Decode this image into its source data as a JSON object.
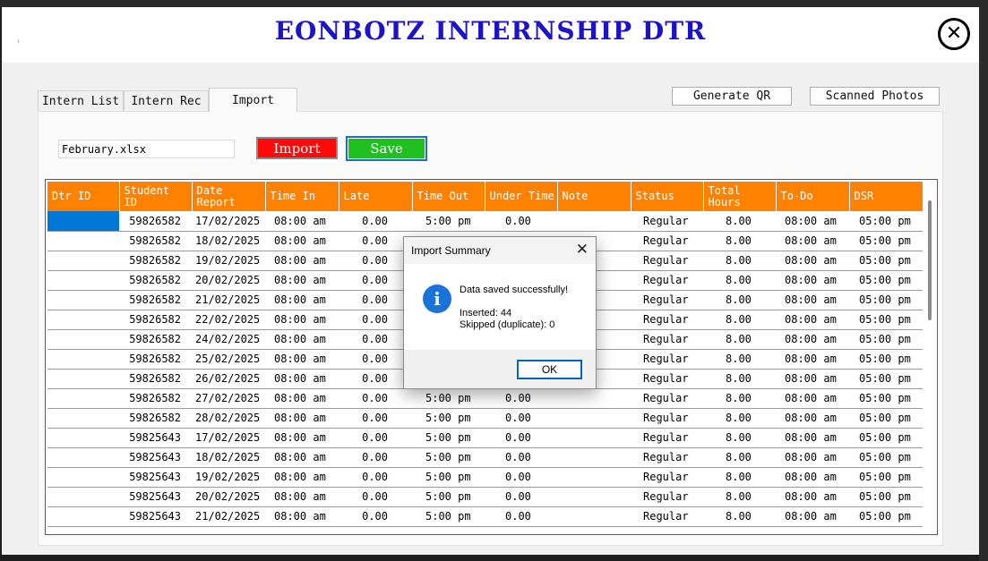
{
  "window": {
    "title": "EONBOTZ INTERNSHIP DTR",
    "close_symbol": "✕"
  },
  "tabs": [
    {
      "label": "Intern List"
    },
    {
      "label": "Intern Rec"
    },
    {
      "label": "Import",
      "active": true
    }
  ],
  "actions": {
    "generate_qr": "Generate QR",
    "scanned_photos": "Scanned Photos"
  },
  "import_panel": {
    "file_name": "February.xlsx",
    "import_label": "Import",
    "save_label": "Save",
    "colors": {
      "import": "#ff0a0a",
      "save": "#1fc01f",
      "header": "#ff8100",
      "title": "#1e12c9"
    }
  },
  "grid": {
    "columns": [
      "Dtr ID",
      "Student ID",
      "Date Report",
      "Time In",
      "Late",
      "Time Out",
      "Under Time",
      "Note",
      "Status",
      "Total Hours",
      "To-Do",
      "DSR"
    ],
    "rows": [
      [
        "",
        "59826582",
        "17/02/2025",
        "08:00 am",
        "0.00",
        "5:00 pm",
        "0.00",
        "",
        "Regular",
        "8.00",
        "08:00 am",
        "05:00 pm"
      ],
      [
        "",
        "59826582",
        "18/02/2025",
        "08:00 am",
        "0.00",
        "",
        "",
        "",
        "Regular",
        "8.00",
        "08:00 am",
        "05:00 pm"
      ],
      [
        "",
        "59826582",
        "19/02/2025",
        "08:00 am",
        "0.00",
        "",
        "",
        "",
        "Regular",
        "8.00",
        "08:00 am",
        "05:00 pm"
      ],
      [
        "",
        "59826582",
        "20/02/2025",
        "08:00 am",
        "0.00",
        "",
        "",
        "",
        "Regular",
        "8.00",
        "08:00 am",
        "05:00 pm"
      ],
      [
        "",
        "59826582",
        "21/02/2025",
        "08:00 am",
        "0.00",
        "",
        "",
        "",
        "Regular",
        "8.00",
        "08:00 am",
        "05:00 pm"
      ],
      [
        "",
        "59826582",
        "22/02/2025",
        "08:00 am",
        "0.00",
        "",
        "",
        "",
        "Regular",
        "8.00",
        "08:00 am",
        "05:00 pm"
      ],
      [
        "",
        "59826582",
        "24/02/2025",
        "08:00 am",
        "0.00",
        "",
        "",
        "",
        "Regular",
        "8.00",
        "08:00 am",
        "05:00 pm"
      ],
      [
        "",
        "59826582",
        "25/02/2025",
        "08:00 am",
        "0.00",
        "",
        "",
        "",
        "Regular",
        "8.00",
        "08:00 am",
        "05:00 pm"
      ],
      [
        "",
        "59826582",
        "26/02/2025",
        "08:00 am",
        "0.00",
        "",
        "",
        "",
        "Regular",
        "8.00",
        "08:00 am",
        "05:00 pm"
      ],
      [
        "",
        "59826582",
        "27/02/2025",
        "08:00 am",
        "0.00",
        "5:00 pm",
        "0.00",
        "",
        "Regular",
        "8.00",
        "08:00 am",
        "05:00 pm"
      ],
      [
        "",
        "59826582",
        "28/02/2025",
        "08:00 am",
        "0.00",
        "5:00 pm",
        "0.00",
        "",
        "Regular",
        "8.00",
        "08:00 am",
        "05:00 pm"
      ],
      [
        "",
        "59825643",
        "17/02/2025",
        "08:00 am",
        "0.00",
        "5:00 pm",
        "0.00",
        "",
        "Regular",
        "8.00",
        "08:00 am",
        "05:00 pm"
      ],
      [
        "",
        "59825643",
        "18/02/2025",
        "08:00 am",
        "0.00",
        "5:00 pm",
        "0.00",
        "",
        "Regular",
        "8.00",
        "08:00 am",
        "05:00 pm"
      ],
      [
        "",
        "59825643",
        "19/02/2025",
        "08:00 am",
        "0.00",
        "5:00 pm",
        "0.00",
        "",
        "Regular",
        "8.00",
        "08:00 am",
        "05:00 pm"
      ],
      [
        "",
        "59825643",
        "20/02/2025",
        "08:00 am",
        "0.00",
        "5:00 pm",
        "0.00",
        "",
        "Regular",
        "8.00",
        "08:00 am",
        "05:00 pm"
      ],
      [
        "",
        "59825643",
        "21/02/2025",
        "08:00 am",
        "0.00",
        "5:00 pm",
        "0.00",
        "",
        "Regular",
        "8.00",
        "08:00 am",
        "05:00 pm"
      ]
    ]
  },
  "dialog": {
    "title": "Import Summary",
    "close_symbol": "✕",
    "icon": "info-icon",
    "icon_glyph": "i",
    "message": "Data saved successfully!",
    "inserted": "Inserted: 44",
    "skipped": "Skipped (duplicate): 0",
    "ok_label": "OK"
  }
}
